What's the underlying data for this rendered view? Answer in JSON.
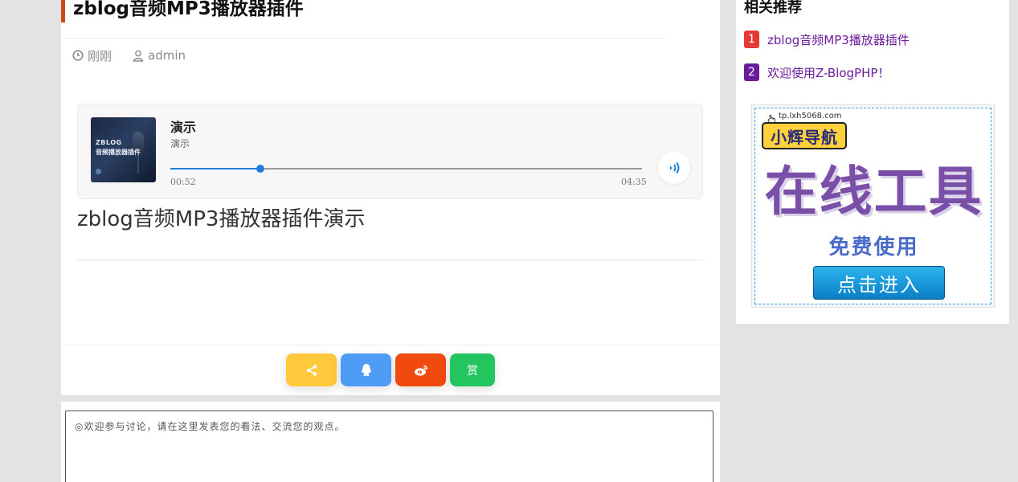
{
  "article": {
    "title": "zblog音频MP3播放器插件",
    "meta": {
      "time": "刚刚",
      "author": "admin"
    },
    "player": {
      "cover_line1": "ZBLOG",
      "cover_line2": "音频播放器插件",
      "track_title": "演示",
      "track_artist": "演示",
      "current_time": "00:52",
      "total_time": "04:35",
      "progress_fraction": 0.19,
      "accent_color": "#1e7fd6"
    },
    "body_text": "zblog音频MP3播放器插件演示",
    "share": {
      "buttons": [
        {
          "icon": "share-icon",
          "color": "#ffc83d"
        },
        {
          "icon": "qq-icon",
          "color": "#4f9cf7"
        },
        {
          "icon": "weibo-icon",
          "color": "#f04a0e"
        },
        {
          "label": "赏",
          "color": "#22c55e"
        }
      ]
    }
  },
  "comment": {
    "placeholder": "◎欢迎参与讨论，请在这里发表您的看法、交流您的观点。"
  },
  "sidebar": {
    "title": "相关推荐",
    "items": [
      {
        "num": "1",
        "label": "zblog音频MP3播放器插件",
        "badge_color": "#e53935"
      },
      {
        "num": "2",
        "label": "欢迎使用Z-BlogPHP！",
        "badge_color": "#6a1b9a"
      }
    ],
    "ad": {
      "url": "tp.lxh5068.com",
      "badge": "小辉导航",
      "headline": "在线工具",
      "subline": "免费使用",
      "cta": "点击进入"
    }
  }
}
